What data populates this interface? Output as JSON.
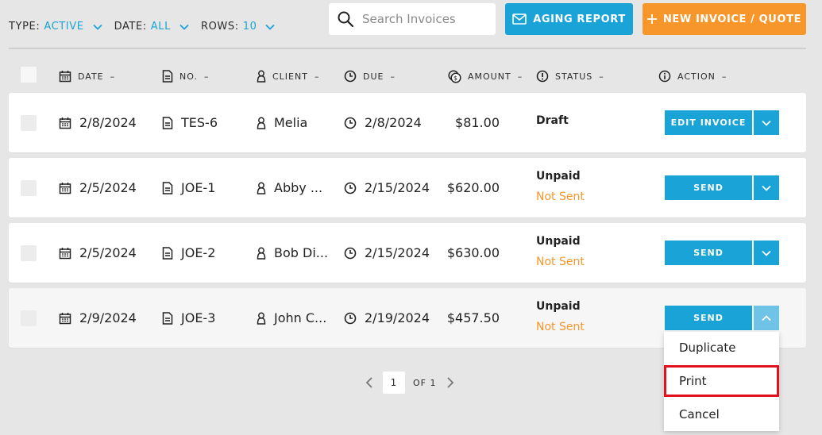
{
  "filters": [
    {
      "label": "TYPE:",
      "value": "ACTIVE"
    },
    {
      "label": "DATE:",
      "value": "ALL"
    },
    {
      "label": "ROWS:",
      "value": "10"
    }
  ],
  "search": {
    "placeholder": "Search Invoices",
    "value": ""
  },
  "toolbar": {
    "aging_label": "AGING REPORT",
    "new_label": "NEW INVOICE / QUOTE"
  },
  "columns": {
    "date": "DATE",
    "no": "NO.",
    "client": "CLIENT",
    "due": "DUE",
    "amount": "AMOUNT",
    "status": "STATUS",
    "action": "ACTION",
    "sort_indicator": "–"
  },
  "rows": [
    {
      "date": "2/8/2024",
      "no": "TES-6",
      "client": "Melia",
      "due": "2/8/2024",
      "amount": "$81.00",
      "status": "Draft",
      "sub_status": "",
      "action": "EDIT INVOICE"
    },
    {
      "date": "2/5/2024",
      "no": "JOE-1",
      "client": "Abby ...",
      "due": "2/15/2024",
      "amount": "$620.00",
      "status": "Unpaid",
      "sub_status": "Not Sent",
      "action": "SEND"
    },
    {
      "date": "2/5/2024",
      "no": "JOE-2",
      "client": "Bob Di...",
      "due": "2/15/2024",
      "amount": "$630.00",
      "status": "Unpaid",
      "sub_status": "Not Sent",
      "action": "SEND"
    },
    {
      "date": "2/9/2024",
      "no": "JOE-3",
      "client": "John C...",
      "due": "2/19/2024",
      "amount": "$457.50",
      "status": "Unpaid",
      "sub_status": "Not Sent",
      "action": "SEND"
    }
  ],
  "dropdown_menu": {
    "items": [
      "Duplicate",
      "Print",
      "Cancel"
    ],
    "highlighted": "Print"
  },
  "pagination": {
    "current": "1",
    "of_label": "OF",
    "total": "1"
  },
  "colors": {
    "accent": "#1aa3d6",
    "orange": "#f7962a",
    "highlight": "#e3101f"
  }
}
